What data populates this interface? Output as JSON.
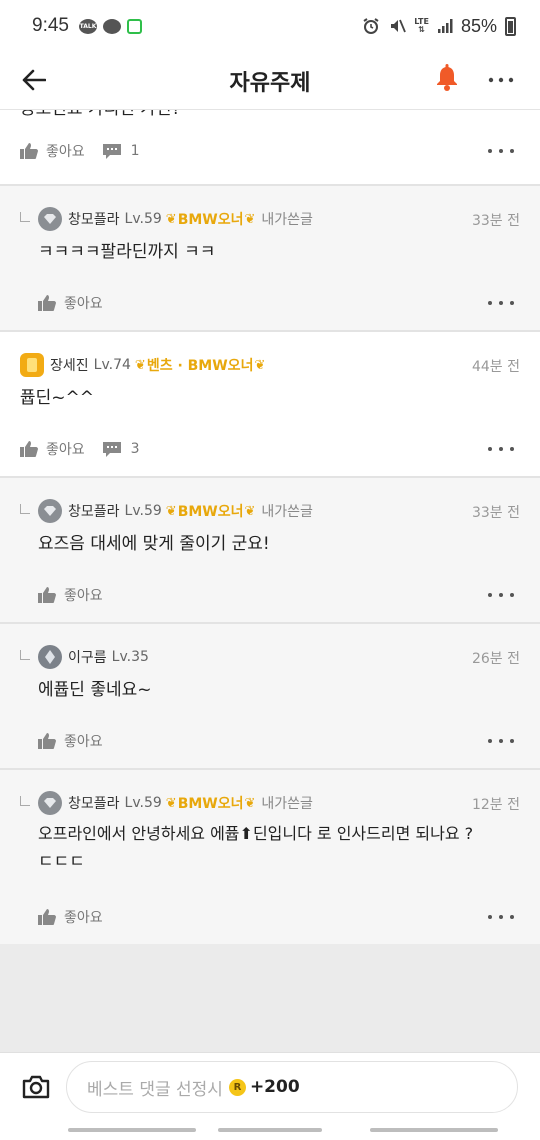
{
  "status_bar": {
    "time": "9:45",
    "battery": "85%",
    "network": "LTE"
  },
  "header": {
    "title": "자유주제",
    "accent_color": "#f05a28"
  },
  "top_item": {
    "cutoff_text": "공소인요 가리면 가면?",
    "like_label": "좋아요",
    "reply_count": "1"
  },
  "comments": [
    {
      "type": "reply",
      "nickname": "창모플라",
      "level": "Lv.59",
      "badge": "BMW오너",
      "author_tag": "내가쓴글",
      "time": "33분 전",
      "lines": [
        "ㅋㅋㅋㅋ팔라딘까지 ㅋㅋ"
      ],
      "like_label": "좋아요"
    },
    {
      "type": "root",
      "nickname": "장세진",
      "level": "Lv.74",
      "badge": "벤츠 · BMW오너",
      "author_tag": "",
      "time": "44분 전",
      "lines": [
        "퓹딘~^^"
      ],
      "like_label": "좋아요",
      "reply_count": "3"
    },
    {
      "type": "reply",
      "nickname": "창모플라",
      "level": "Lv.59",
      "badge": "BMW오너",
      "author_tag": "내가쓴글",
      "time": "33분 전",
      "lines": [
        "요즈음 대세에 맞게 줄이기 군요!"
      ],
      "like_label": "좋아요"
    },
    {
      "type": "reply",
      "nickname": "이구름",
      "level": "Lv.35",
      "badge": "",
      "author_tag": "",
      "time": "26분 전",
      "lines": [
        "에퓹딘 좋네요~"
      ],
      "like_label": "좋아요"
    },
    {
      "type": "reply",
      "nickname": "창모플라",
      "level": "Lv.59",
      "badge": "BMW오너",
      "author_tag": "내가쓴글",
      "time": "12분 전",
      "lines": [
        "오프라인에서 안녕하세요 에퓹⬆딘입니다 로 인사드리면 되나요 ?",
        "ㄷㄷㄷ"
      ],
      "like_label": "좋아요"
    }
  ],
  "input": {
    "placeholder": "베스트 댓글 선정시",
    "point_symbol": "R",
    "point_value": "+200"
  },
  "icons": {
    "back": "back-arrow-icon",
    "bell": "bell-icon",
    "more": "more-icon",
    "thumb": "thumbs-up-icon",
    "chat": "chat-bubble-icon",
    "camera": "camera-icon"
  }
}
